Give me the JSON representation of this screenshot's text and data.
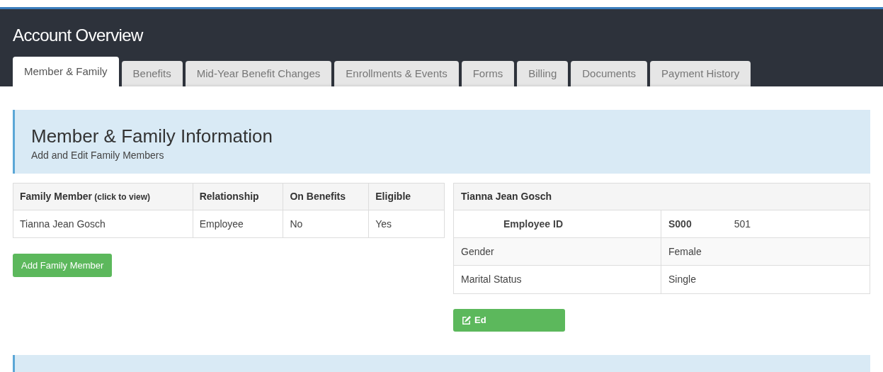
{
  "header": {
    "title": "Account Overview"
  },
  "tabs": [
    {
      "label": "Member & Family",
      "selected": true
    },
    {
      "label": "Benefits",
      "selected": false
    },
    {
      "label": "Mid-Year Benefit Changes",
      "selected": false
    },
    {
      "label": "Enrollments & Events",
      "selected": false
    },
    {
      "label": "Forms",
      "selected": false
    },
    {
      "label": "Billing",
      "selected": false
    },
    {
      "label": "Documents",
      "selected": false
    },
    {
      "label": "Payment History",
      "selected": false
    }
  ],
  "section": {
    "title": "Member & Family Information",
    "subtitle": "Add and Edit Family Members"
  },
  "family_table": {
    "columns": [
      {
        "label": "Family Member",
        "note": "(click to view)"
      },
      {
        "label": "Relationship"
      },
      {
        "label": "On Benefits"
      },
      {
        "label": "Eligible"
      }
    ],
    "rows": [
      {
        "cells": [
          "Tianna Jean Gosch",
          "Employee",
          "No",
          "Yes"
        ]
      }
    ]
  },
  "add_button": "Add Family Member",
  "member_panel": {
    "title": "Tianna Jean Gosch",
    "rows": [
      {
        "label": "Employee ID",
        "value": "S000",
        "value_end": "501",
        "bold": true
      },
      {
        "label": "Gender",
        "value": "Female",
        "bold": false
      },
      {
        "label": "Marital Status",
        "value": "Single",
        "bold": false
      }
    ],
    "edit_button": "Ed"
  }
}
